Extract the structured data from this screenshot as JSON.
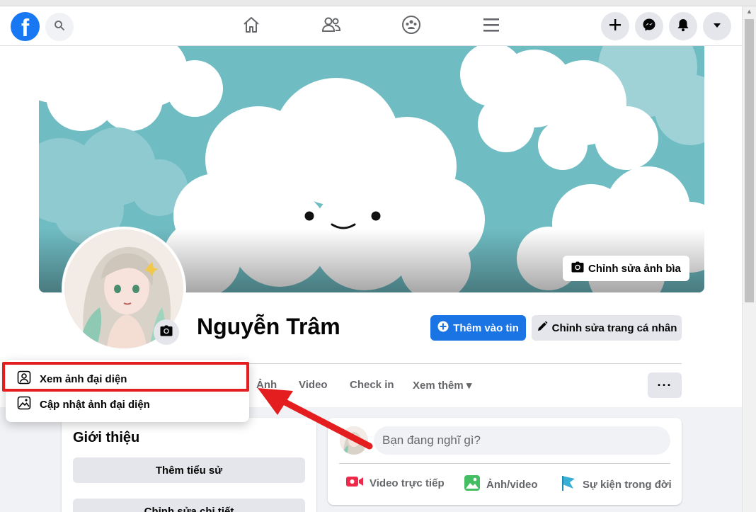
{
  "nav": {
    "logo_letter": "f",
    "icons": [
      "search-icon",
      "home-icon",
      "friends-icon",
      "groups-icon",
      "menu-icon",
      "plus-icon",
      "messenger-icon",
      "bell-icon",
      "caret-down-icon"
    ]
  },
  "cover": {
    "edit_label": "Chỉnh sửa ảnh bìa"
  },
  "profile": {
    "name": "Nguyễn Trâm",
    "add_story_label": "Thêm vào tin",
    "edit_profile_label": "Chỉnh sửa trang cá nhân"
  },
  "tabs": {
    "photos": "Ảnh",
    "video": "Video",
    "checkin": "Check in",
    "more": "Xem thêm",
    "more_caret": "▾",
    "overflow": "···"
  },
  "dropdown": {
    "view_avatar": "Xem ảnh đại diện",
    "update_avatar": "Cập nhật ảnh đại diện"
  },
  "intro": {
    "title": "Giới thiệu",
    "add_bio": "Thêm tiểu sử",
    "edit_details": "Chỉnh sửa chi tiết"
  },
  "composer": {
    "placeholder": "Bạn đang nghĩ gì?",
    "live_video": "Video trực tiếp",
    "photo_video": "Ảnh/video",
    "life_event": "Sự kiện trong đời"
  },
  "colors": {
    "brand": "#1877f2",
    "highlight": "#e41e1e",
    "cover_sky": "#6fbcc3"
  }
}
